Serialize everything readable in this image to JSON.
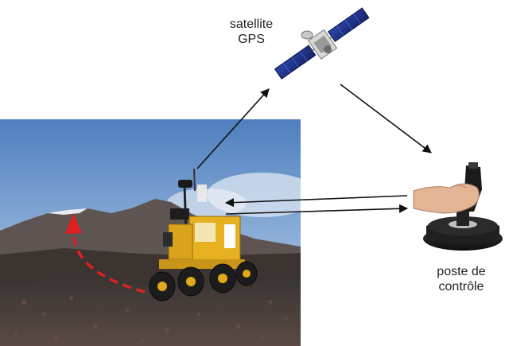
{
  "labels": {
    "satellite_line1": "satellite",
    "satellite_line2": "GPS",
    "control_line1": "poste de",
    "control_line2": "contrôle"
  },
  "colors": {
    "arrow": "#111111",
    "path_arrow": "#e02020",
    "sky_top": "#5a86c3",
    "sky_bottom": "#c9dbee",
    "robot_body": "#e8b21a",
    "ground": "#4a3f3a"
  },
  "icons": [
    "satellite-icon",
    "robot-rover",
    "joystick-icon"
  ]
}
